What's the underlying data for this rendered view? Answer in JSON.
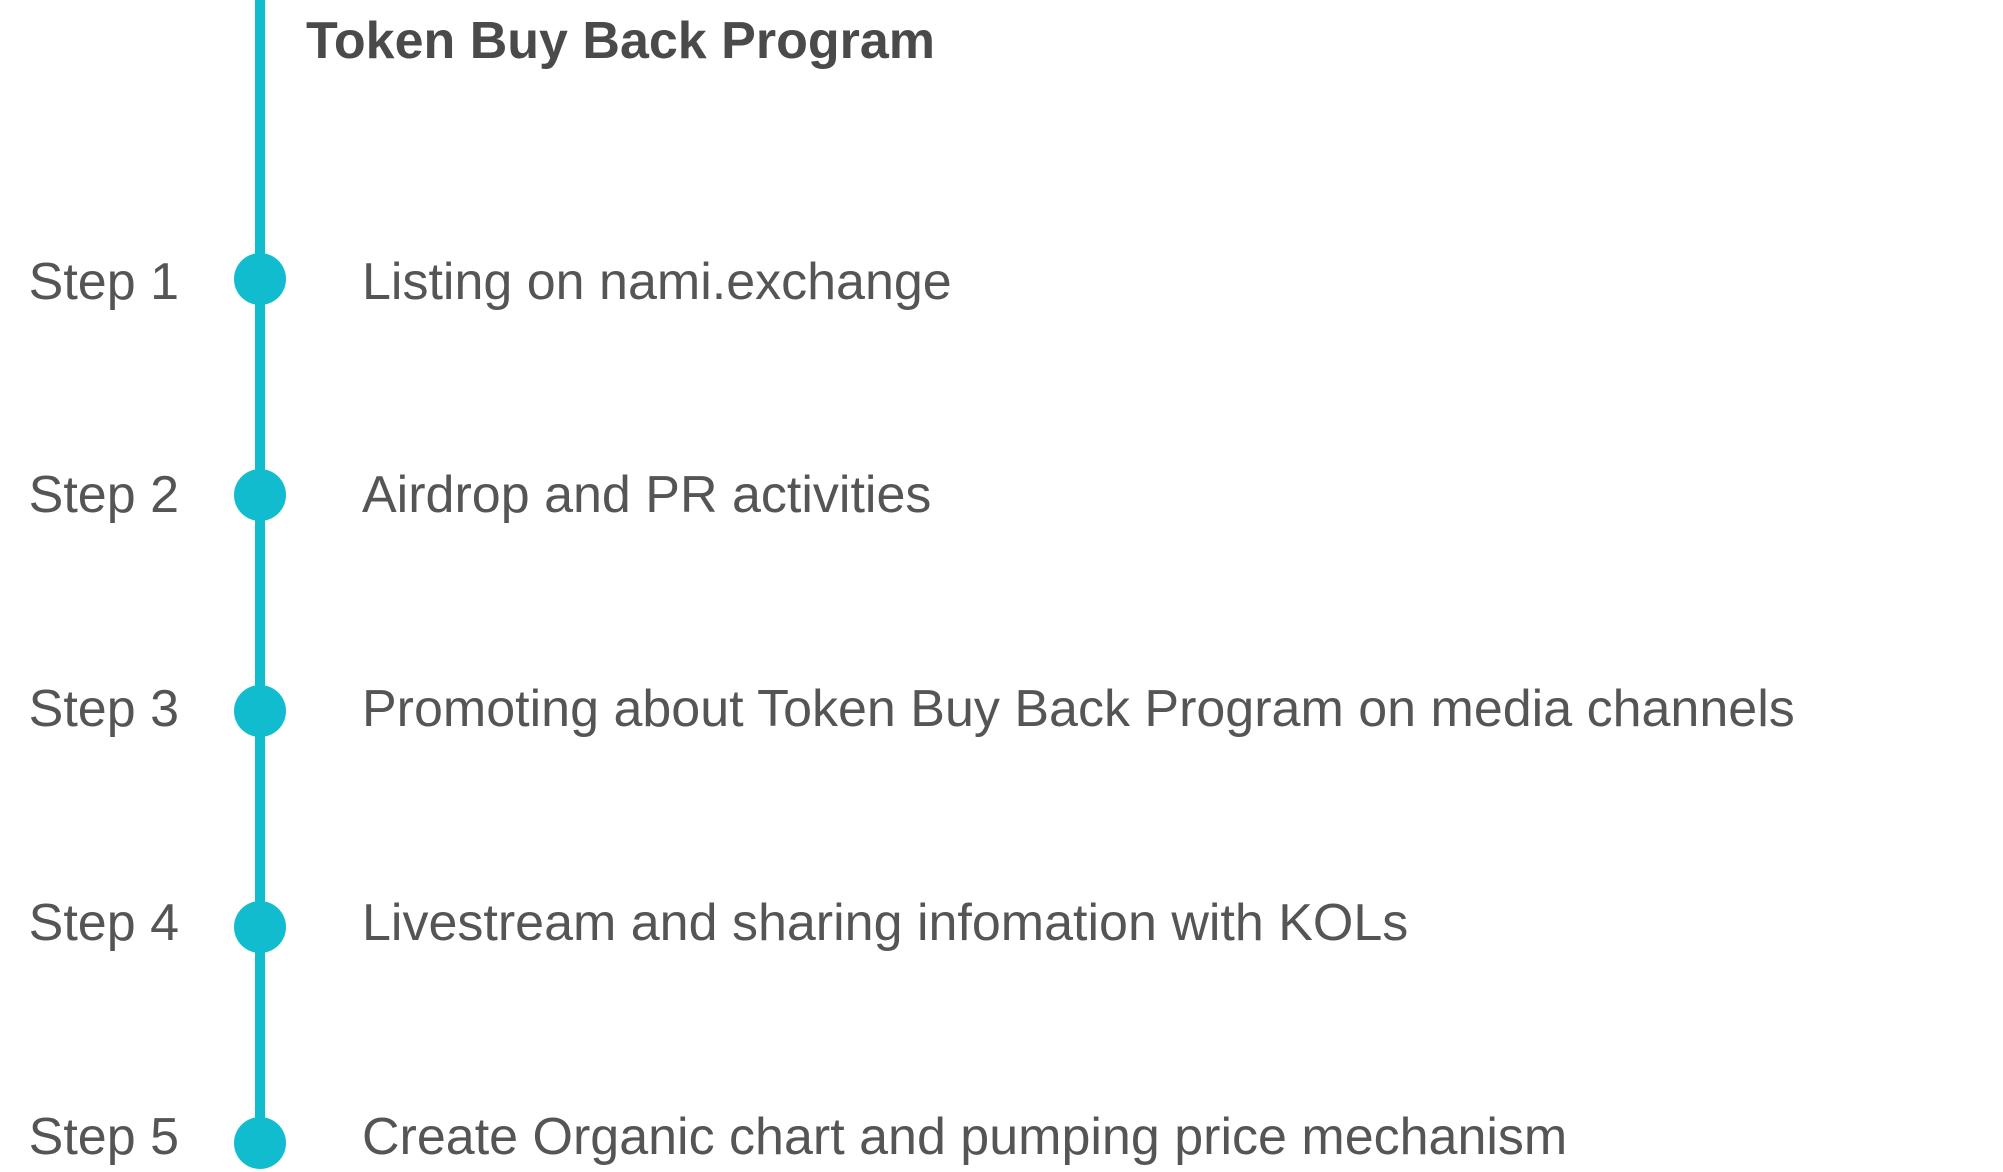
{
  "title": "Token Buy Back Program",
  "accent_color": "#12bccf",
  "steps": [
    {
      "label": "Step 1",
      "text": "Listing on nami.exchange"
    },
    {
      "label": "Step 2",
      "text": "Airdrop and PR activities"
    },
    {
      "label": "Step 3",
      "text": "Promoting about Token Buy Back Program on media channels"
    },
    {
      "label": "Step 4",
      "text": "Livestream and sharing infomation with KOLs"
    },
    {
      "label": "Step 5",
      "text": "Create Organic chart and pumping price mechanism"
    }
  ]
}
